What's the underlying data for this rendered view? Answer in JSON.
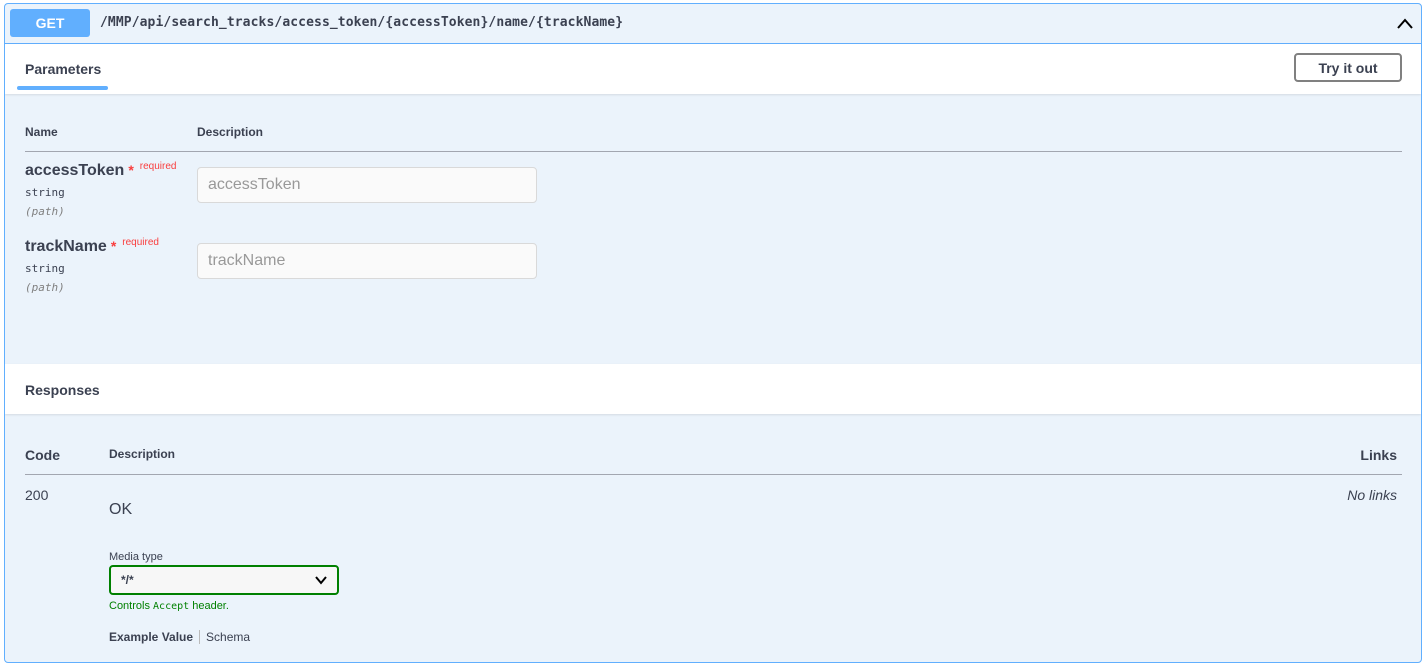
{
  "endpoint": {
    "method": "GET",
    "path": "/MMP/api/search_tracks/access_token/{accessToken}/name/{trackName}"
  },
  "parameters_section": {
    "tab_label": "Parameters",
    "try_button": "Try it out",
    "col_name": "Name",
    "col_description": "Description",
    "params": [
      {
        "name": "accessToken",
        "star": "*",
        "required": "required",
        "type": "string",
        "in": "(path)",
        "placeholder": "accessToken"
      },
      {
        "name": "trackName",
        "star": "*",
        "required": "required",
        "type": "string",
        "in": "(path)",
        "placeholder": "trackName"
      }
    ]
  },
  "responses_section": {
    "title": "Responses",
    "col_code": "Code",
    "col_description": "Description",
    "col_links": "Links",
    "responses": [
      {
        "code": "200",
        "description": "OK",
        "links": "No links",
        "media_type_label": "Media type",
        "media_type_value": "*/*",
        "controls_prefix": "Controls",
        "controls_code": "Accept",
        "controls_suffix": "header.",
        "example_tab": "Example Value",
        "schema_tab": "Schema"
      }
    ]
  },
  "colors": {
    "get_blue": "#61affe",
    "required_red": "#f93e3e",
    "accept_green": "#008000"
  },
  "icons": [
    "chevron-up-icon",
    "chevron-down-icon"
  ]
}
